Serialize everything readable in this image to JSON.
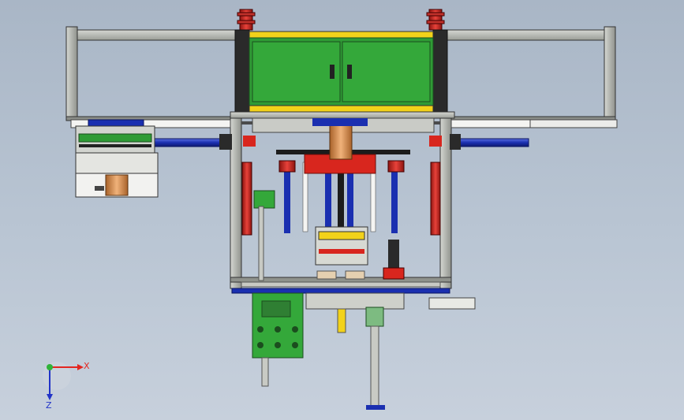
{
  "triad": {
    "x_label": "X",
    "z_label": "Z"
  },
  "colors": {
    "background": "#b4c0cf",
    "frame": "#a9aca6",
    "cabinet": "#2f9b35",
    "accent_yellow": "#f2d21a",
    "accent_red": "#d8261e",
    "accent_blue": "#1a2fb0"
  }
}
